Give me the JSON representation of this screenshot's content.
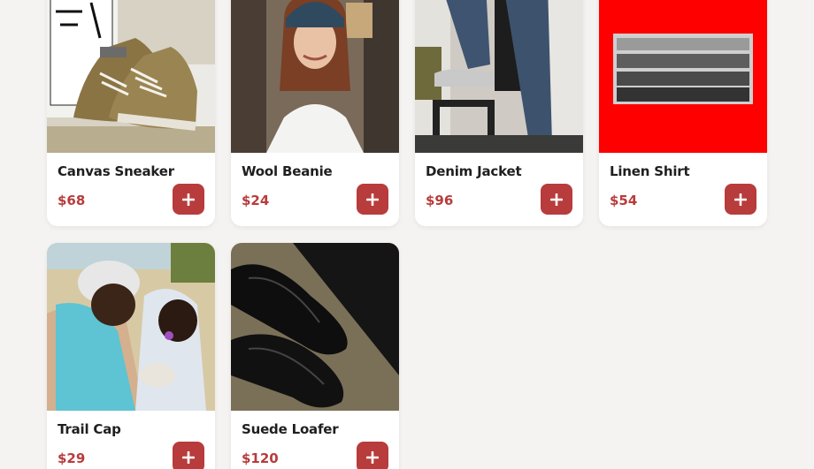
{
  "products": [
    {
      "name": "Canvas Sneaker",
      "price": "$68",
      "image": "sneaker-photo"
    },
    {
      "name": "Wool Beanie",
      "price": "$24",
      "image": "beanie-model-photo"
    },
    {
      "name": "Denim Jacket",
      "price": "$96",
      "image": "denim-legs-photo"
    },
    {
      "name": "Linen Shirt",
      "price": "$54",
      "image": "group-photo-red-frame"
    },
    {
      "name": "Trail Cap",
      "price": "$29",
      "image": "mother-child-photo"
    },
    {
      "name": "Suede Loafer",
      "price": "$120",
      "image": "black-loafers-photo"
    }
  ],
  "icons": {
    "add": "plus-icon"
  },
  "colors": {
    "accent": "#b83c3c",
    "background": "#f4f3f1",
    "card": "#ffffff",
    "red_frame": "#ff0000"
  }
}
